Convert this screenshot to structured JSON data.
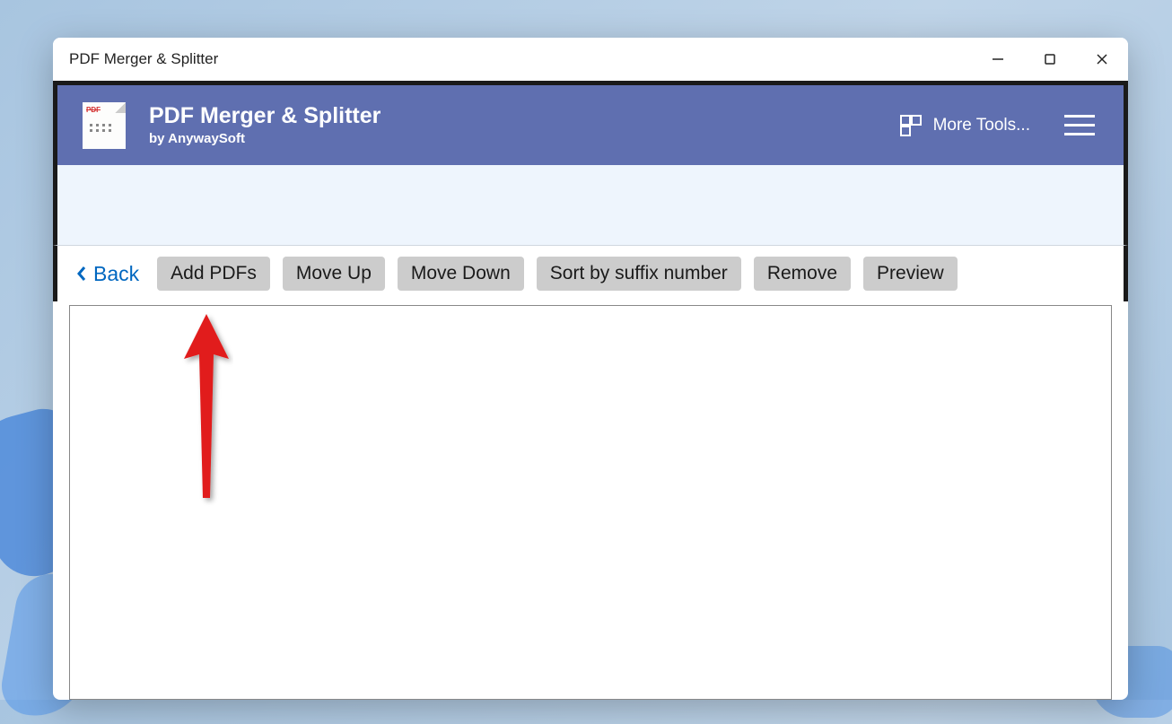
{
  "window": {
    "title": "PDF Merger & Splitter"
  },
  "header": {
    "app_title": "PDF Merger & Splitter",
    "app_subtitle": "by AnywaySoft",
    "more_tools_label": "More Tools...",
    "logo_badge": "PDF"
  },
  "toolbar": {
    "back_label": "Back",
    "buttons": {
      "add_pdfs": "Add PDFs",
      "move_up": "Move Up",
      "move_down": "Move Down",
      "sort_suffix": "Sort by suffix number",
      "remove": "Remove",
      "preview": "Preview"
    }
  },
  "colors": {
    "header_bg": "#5f6fb0",
    "accent_link": "#0067c0",
    "button_bg": "#cccccc",
    "arrow": "#e11b1b"
  }
}
